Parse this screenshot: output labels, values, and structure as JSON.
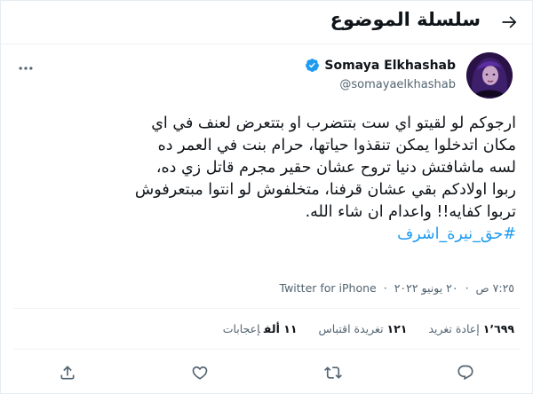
{
  "header": {
    "title": "سلسلة الموضوع",
    "back_icon": "arrow-left-icon"
  },
  "author": {
    "display_name": "Somaya Elkhashab",
    "handle": "@somayaelkhashab",
    "verified": true,
    "verified_color": "#1d9bf0"
  },
  "tweet": {
    "lines": [
      "ارجوكم لو لقيتو اي ست بتتضرب او بتتعرض لعنف في اي",
      "مكان اتدخلوا يمكن تنقذوا حياتها، حرام بنت في العمر ده",
      "لسه ماشافتش دنيا تروح عشان حقير مجرم قاتل زي ده،",
      "ربوا اولادكم بقي عشان قرفنا، متخلفوش لو انتوا مبتعرفوش",
      "تربوا كفايه!! واعدام ان شاء الله."
    ],
    "hashtag": "#حق_نيرة_اشرف"
  },
  "meta": {
    "time": "٧:٢٥ ص",
    "date": "٢٠ يونيو ٢٠٢٢",
    "source": "Twitter for iPhone"
  },
  "stats": {
    "retweets_count": "١٬٦٩٩",
    "retweets_label": "إعادة تغريد",
    "quotes_count": "١٢١",
    "quotes_label": "تغريدة اقتباس",
    "likes_count": "١١ ألف",
    "likes_label": "إعجابات"
  },
  "actions": {
    "reply_icon": "reply-icon",
    "retweet_icon": "retweet-icon",
    "like_icon": "heart-icon",
    "share_icon": "share-icon"
  },
  "colors": {
    "link": "#1d9bf0",
    "secondary_text": "#536471",
    "primary_text": "#0f1419"
  }
}
